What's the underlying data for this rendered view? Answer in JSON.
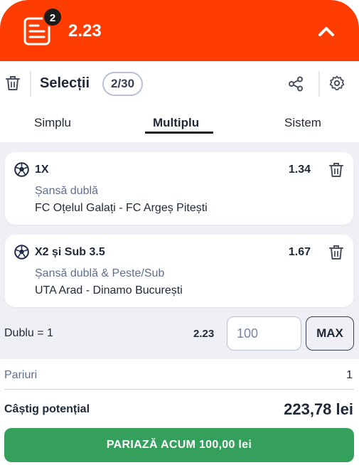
{
  "header": {
    "selection_count_badge": "2",
    "total_odds": "2.23",
    "accent_color": "#ff3d00"
  },
  "toolbar": {
    "title": "Selecții",
    "count": "2/30"
  },
  "tabs": [
    {
      "label": "Simplu",
      "active": false
    },
    {
      "label": "Multiplu",
      "active": true
    },
    {
      "label": "Sistem",
      "active": false
    }
  ],
  "selections": [
    {
      "icon": "football-icon",
      "selection": "1X",
      "odds": "1.34",
      "market": "Șansă dublă",
      "event": "FC Oțelul Galați - FC Argeș Pitești"
    },
    {
      "icon": "football-icon",
      "selection": "X2 și Sub 3.5",
      "odds": "1.67",
      "market": "Șansă dublă & Peste/Sub",
      "event": "UTA Arad - Dinamo București"
    }
  ],
  "stake": {
    "label": "Dublu = 1",
    "odds": "2.23",
    "input_value": "100",
    "max_label": "MAX"
  },
  "summary": {
    "bets_label": "Pariuri",
    "bets_value": "1",
    "potential_label": "Câștig potențial",
    "potential_value": "223,78 lei"
  },
  "place_bet_label": "PARIAZĂ ACUM 100,00 lei",
  "button_color": "#35a05c"
}
